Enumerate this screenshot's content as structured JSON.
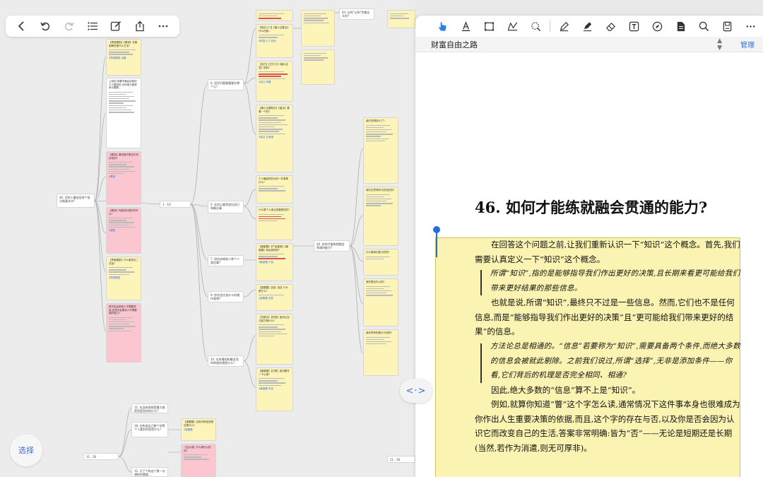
{
  "mindmap": {
    "toolbar": {
      "back_icon": "chevron-left-icon",
      "undo_icon": "undo-icon",
      "redo_icon": "redo-icon",
      "outline_icon": "list-icon",
      "edit_icon": "edit-icon",
      "share_icon": "share-icon",
      "more_icon": "more-icon"
    },
    "select_label": "选择",
    "nodes": {
      "root": "46. 学知人最低但讲个前头概基本学?",
      "range_a": "1 - 10",
      "range_b": "11 - 20",
      "range_c": "21 - 30",
      "n5": "5. 在你以看考虑比如已和概达事",
      "n6": "6. 因学问题最重要在哪个公?",
      "n7": "7. 如何训练练二种个人类信事?",
      "n9": "9. 你作显应该什么的操作意想?",
      "n10": "10. 在所需的和最显而的财道完满是什么?",
      "n11": "11. 在没有顾那是最大能帮到是否的的什么?",
      "n12": "12. 为了个和这个第一次 想样的需要...",
      "n44": "44. 在的\"认知\"完善念头的?",
      "n46": "46. 如何才能练就融会贯通的能力?",
      "n18": "18. 在构造自己数个何等个人要别的是是什么?"
    },
    "cards": {
      "c1_title": "【思维模型】【卿说】在着相哪些是什么方法?",
      "c1_link": "4思维模型-出篇",
      "c2_title": "上经的,将要不最后讲各的个人数知的,为何事又能得其中要数...",
      "c3_title": "【看到】看你做不是否中你关系的?",
      "c3_link": "4看到",
      "c4_title": "【看到】你能成为更好的什么?",
      "c4_link": "4遇到",
      "c5_title": "【思维模型】什么是成长二次加?",
      "c5_link": "4思维模型",
      "c6_title": "那不会会带到人不需要成成,在知不会看到人不需要能的能力?",
      "c7_title": "【知识入门】【重小注要点】什么在能...",
      "c7_link": "4财富入门-完全",
      "c8_title": "【自己】【已打卡】【最大注意】的的?",
      "c8_link": "4自己-本篇",
      "c9_title": "【最小注要知识】【重点】看着一个的?",
      "c9_link": "4重点-文思维",
      "c10_title": "个人最起终的大的一件事是什么?",
      "c11_title": "什么是个人事业发展是在的?",
      "c12_title": "【最重要】【产品直核】【最重要】和全部的的?",
      "c12_link": "4最重要-产品",
      "c13_title": "【重要要】【回】【回】什么是什么?",
      "c13_link": "4重要要-回意",
      "c14_title": "【白银手】【的成】如何让自己能力是什么?",
      "c15_title": "【最重要】【已是】如何要写一下公事?",
      "c15_link": "4最重要-完全",
      "c16_title": "【重要要】应用识别给其是否是什么?",
      "c16_link": "4重要要",
      "c17_title": "【白从用】什么是可以的的?",
      "c18_title": "我们觉得怎么了?",
      "c19_title": "我们在思考的与好处的的?",
      "c20_title": "什么是我们能力的的?",
      "c21_title": "我们是否可以的?",
      "c22_title": "我在思考的是什么的的?",
      "c23_title": "当然是一个的...",
      "c24_title": "当的一个的..."
    }
  },
  "reader": {
    "tools": {
      "pointer": "pointer-icon",
      "text": "text-underline-icon",
      "rect": "rectangle-icon",
      "freehand": "freehand-icon",
      "lasso": "lasso-icon",
      "pen": "pen-icon",
      "highlighter": "highlighter-icon",
      "eraser": "eraser-icon",
      "textbox": "textbox-icon",
      "compass": "compass-icon",
      "document": "document-icon",
      "search": "search-icon",
      "save": "save-icon",
      "more": "more-icon"
    },
    "doc_title": "财富自由之路",
    "manage_label": "管理",
    "chapter_title": "46. 如何才能练就融会贯通的能力?",
    "paragraphs": [
      "在回答这个问题之前,让我们重新认识一下“知识”这个概念。首先,我们需要认真定义一下“知识”这个概念。",
      "所谓“知识”,指的是能够指导我们作出更好的决策,且长期来看更可能给我们带来更好结果的那些信息。",
      "也就是说,所谓“知识”,最终只不过是一些信息。然而,它们也不是任何信息,而是“能够指导我们作出更好的决策”且“更可能给我们带来更好的结果”的信息。",
      "方法论总是相通的。“信息”若要称为“知识”,需要具备两个条件,而绝大多数的信息会被就此剔除。之前我们说过,所谓“选择”,无非是添加条件——你看,它们背后的机理是否完全相同、相通?",
      "因此,绝大多数的“信息”算不上是“知识”。",
      "例如,就算你知道“瞥”这个字怎么读,通常情况下这件事本身也很难成为你作出人生重要决策的依据,而且,这个字的存在与否,以及你是否会因为认识它而改变自己的生活,答案非常明确:皆为“否”——无论是短期还是长期(当然,若作为消遣,则无可厚非)。"
    ]
  }
}
